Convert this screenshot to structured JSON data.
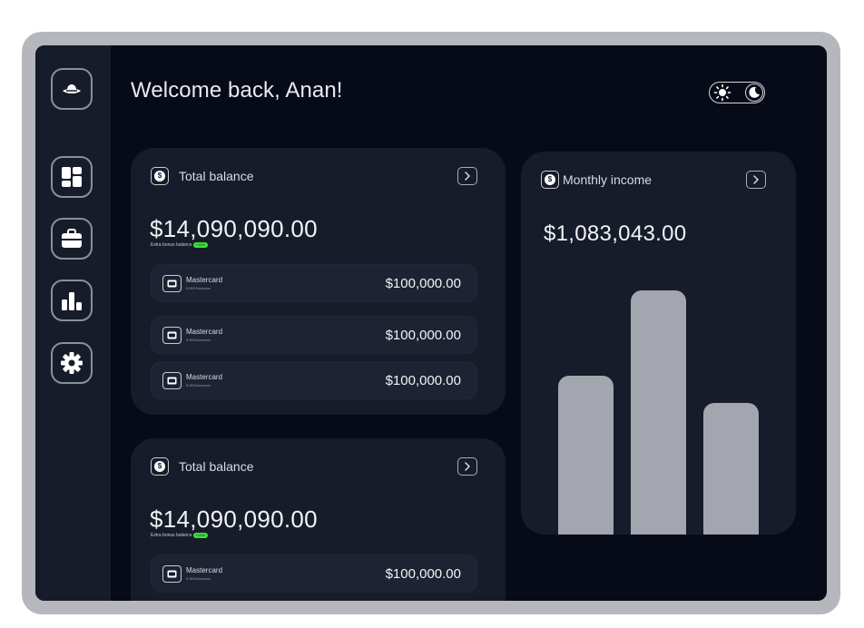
{
  "header": {
    "welcome": "Welcome back, Anan!"
  },
  "sidebar": {
    "items": [
      {
        "name": "logo",
        "icon": "hat-icon"
      },
      {
        "name": "dashboard",
        "icon": "dashboard-icon"
      },
      {
        "name": "wallet",
        "icon": "briefcase-icon"
      },
      {
        "name": "analytics",
        "icon": "bar-chart-icon"
      },
      {
        "name": "settings",
        "icon": "gear-icon"
      }
    ]
  },
  "theme_toggle": {
    "modes": [
      "light",
      "dark"
    ],
    "active": "dark"
  },
  "balance_cards": [
    {
      "title": "Total balance",
      "amount": "$14,090,090.00",
      "bonus_label": "Extra bonus balance",
      "bonus_badge": "+10%",
      "rows": [
        {
          "name": "Mastercard",
          "number": "0.90XXxxxxxxx",
          "amount": "$100,000.00"
        },
        {
          "name": "Mastercard",
          "number": "0.90XXxxxxxxx",
          "amount": "$100,000.00"
        },
        {
          "name": "Mastercard",
          "number": "0.90XXxxxxxxx",
          "amount": "$100,000.00"
        }
      ]
    },
    {
      "title": "Total balance",
      "amount": "$14,090,090.00",
      "bonus_label": "Extra bonus balance",
      "bonus_badge": "+10%",
      "rows": [
        {
          "name": "Mastercard",
          "number": "0.90XXxxxxxxx",
          "amount": "$100,000.00"
        }
      ]
    }
  ],
  "monthly_income": {
    "title": "Monthly income",
    "amount": "$1,083,043.00"
  },
  "chart_data": {
    "type": "bar",
    "categories": [
      "",
      "",
      ""
    ],
    "values": [
      0.65,
      1.0,
      0.54
    ],
    "color": "#a3a6ae"
  },
  "colors": {
    "background": "#060b17",
    "card": "#171c2a",
    "sidebar": "#171c2a",
    "accent_green": "#39e23a",
    "device_frame": "#b5b7bd"
  }
}
